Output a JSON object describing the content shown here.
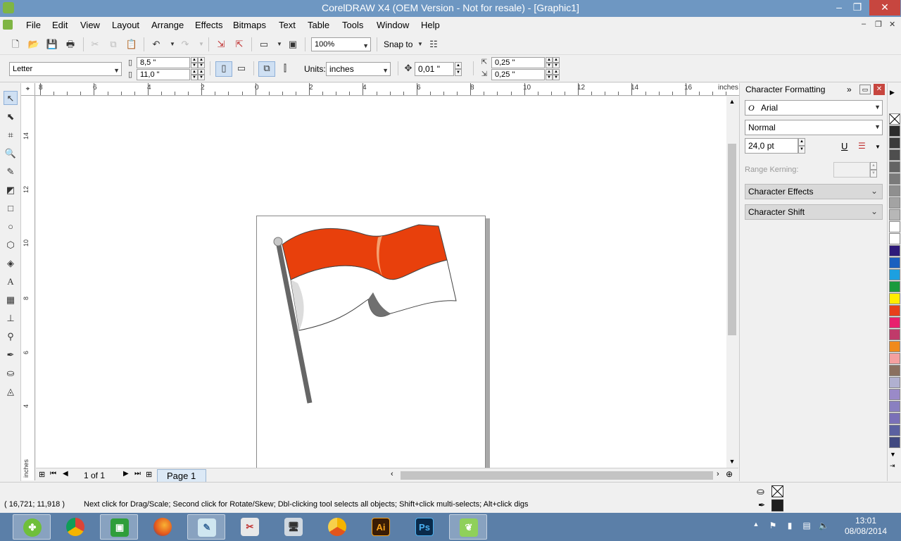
{
  "window": {
    "title": "CorelDRAW X4 (OEM Version - Not for resale) - [Graphic1]",
    "minimize": "–",
    "maximize": "❐",
    "close": "✕"
  },
  "menu": {
    "items": [
      "File",
      "Edit",
      "View",
      "Layout",
      "Arrange",
      "Effects",
      "Bitmaps",
      "Text",
      "Table",
      "Tools",
      "Window",
      "Help"
    ],
    "mdi_min": "–",
    "mdi_restore": "❐",
    "mdi_close": "✕"
  },
  "toolbar1": {
    "zoom_value": "100%",
    "snap_label": "Snap to"
  },
  "propertybar": {
    "paper_size": "Letter",
    "width": "8,5 \"",
    "height": "11,0 \"",
    "units_label": "Units:",
    "units_value": "inches",
    "nudge": "0,01 \"",
    "dup_x": "0,25 \"",
    "dup_y": "0,25 \""
  },
  "ruler": {
    "top_labels": [
      "8",
      "6",
      "4",
      "2",
      "0",
      "2",
      "4",
      "6",
      "8",
      "10",
      "12",
      "14",
      "16"
    ],
    "top_unit": "inches",
    "left_labels": [
      "14",
      "12",
      "10",
      "8",
      "6",
      "4"
    ],
    "left_unit": "inches"
  },
  "pagenav": {
    "page_count": "1 of 1",
    "page_tab": "Page 1"
  },
  "docker": {
    "title": "Character Formatting",
    "font": "Arial",
    "style": "Normal",
    "size": "24,0 pt",
    "range_kerning_label": "Range Kerning:",
    "section_effects": "Character Effects",
    "section_shift": "Character Shift"
  },
  "palette": {
    "colors": [
      "#2b2b2b",
      "#3a3a3a",
      "#4e4e4e",
      "#646464",
      "#7a7a7a",
      "#8f8f8f",
      "#a3a3a3",
      "#b7b7b7",
      "#ffffff",
      "#ffffff",
      "#2e1a7a",
      "#1a5fbf",
      "#1ca0e0",
      "#1a9a3c",
      "#ffed00",
      "#e8401c",
      "#e8206e",
      "#c03a6a",
      "#f08a1c",
      "#f4a0a0",
      "#8a7060",
      "#b0b0d0",
      "#9a8ac8",
      "#8a80c0",
      "#7a70b8",
      "#5a60a0",
      "#404880"
    ]
  },
  "status": {
    "coords": "( 16,721; 11,918 )",
    "message": "Next click for Drag/Scale; Second click for Rotate/Skew; Dbl-clicking tool selects all objects; Shift+click multi-selects; Alt+click digs"
  },
  "taskbar": {
    "apps": [
      "clover",
      "chrome",
      "camtasia",
      "firefox",
      "coreldraw-notes",
      "snipping",
      "remote",
      "chrome-canary",
      "illustrator",
      "photoshop",
      "coreldraw"
    ],
    "ai_label": "Ai",
    "ps_label": "Ps",
    "time": "13:01",
    "date": "08/08/2014"
  },
  "colors": {
    "flag_red": "#e8400c",
    "flag_white": "#ffffff",
    "pole": "#666666",
    "titlebar": "#6e97c2",
    "taskbar": "#5b7fa8"
  }
}
